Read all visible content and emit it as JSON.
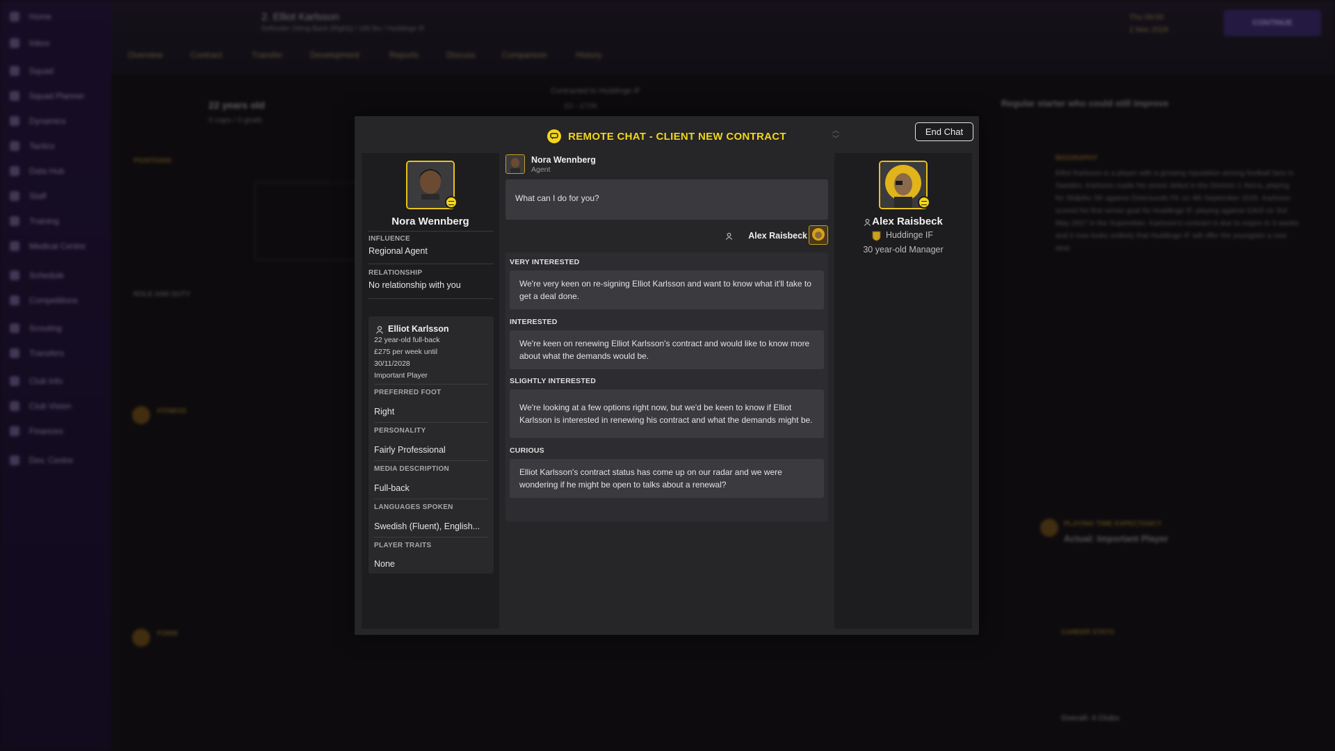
{
  "background": {
    "sidebar_items": [
      "Home",
      "Inbox",
      "Squad",
      "Squad Planner",
      "Dynamics",
      "Tactics",
      "Data Hub",
      "Staff",
      "Training",
      "Medical Centre",
      "Schedule",
      "Competitions",
      "Scouting",
      "Transfers",
      "Club Info",
      "Club Vision",
      "Finances",
      "Dev. Centre"
    ],
    "player_name": "2. Elliot Karlsson",
    "player_sub": "Defender (Wing-Back (Right)) / 180 lbs / Huddinge IF",
    "tabs": [
      "Overview",
      "Contract",
      "Transfer",
      "Development",
      "Reports",
      "Discuss",
      "Comparison",
      "History"
    ],
    "continue_label": "CONTINUE",
    "date_line1": "Thu 09:00",
    "date_line2": "2 Nov 2028",
    "age_text": "22 years old",
    "caps_text": "0 caps / 0 goals",
    "contract_text": "Contracted to Huddinge IF",
    "value_text": "£0 - £70K",
    "summary_text": "Regular starter who could still improve",
    "positions_label": "POSITIONS",
    "roles_label": "ROLE AND DUTY",
    "fitness_label": "FITNESS",
    "form_label": "FORM",
    "biography_label": "BIOGRAPHY",
    "biography_text": "Elliot Karlsson is a player with a growing reputation among football fans in Sweden. Karlsson made his senior debut in the Division 1 Norra, playing for Skiljebo SK against Östersunds FK on 4th September 2025. Karlsson scored his first senior goal for Huddinge IF, playing against GAIS on 3rd May 2027 in the Superettan. Karlsson's contract is due to expire in 3 weeks and it now looks unlikely that Huddinge IF will offer the youngster a new deal.",
    "playing_time_label": "PLAYING TIME EXPECTANCY",
    "playing_time_text": "Actual: Important Player",
    "career_label": "CAREER STATS",
    "overall_text": "Overall: 4 Clubs"
  },
  "modal": {
    "title": "REMOTE CHAT - CLIENT NEW CONTRACT",
    "end_chat_label": "End Chat",
    "agent": {
      "name": "Nora Wennberg",
      "influence_label": "INFLUENCE",
      "influence_value": "Regional Agent",
      "relationship_label": "RELATIONSHIP",
      "relationship_value": "No relationship with you"
    },
    "client": {
      "name": "Elliot Karlsson",
      "age_position": "22 year-old full-back",
      "wage_line1": "£275 per week until",
      "wage_line2": "30/11/2028",
      "status": "Important Player",
      "preferred_foot_label": "PREFERRED FOOT",
      "preferred_foot_value": "Right",
      "personality_label": "PERSONALITY",
      "personality_value": "Fairly Professional",
      "media_label": "MEDIA DESCRIPTION",
      "media_value": "Full-back",
      "languages_label": "LANGUAGES SPOKEN",
      "languages_value": "Swedish (Fluent), English...",
      "traits_label": "PLAYER TRAITS",
      "traits_value": "None"
    },
    "chat": {
      "speaker_name": "Nora Wennberg",
      "speaker_role": "Agent",
      "question": "What can I do for you?",
      "reply_name": "Alex Raisbeck",
      "options": [
        {
          "label": "VERY INTERESTED",
          "text": "We're very keen on re-signing Elliot Karlsson and want to know what it'll take to get a deal done."
        },
        {
          "label": "INTERESTED",
          "text": "We're keen on renewing Elliot Karlsson's contract and would like to know more about what the demands would be."
        },
        {
          "label": "SLIGHTLY INTERESTED",
          "text": "We're looking at a few options right now, but we'd be keen to know if Elliot Karlsson is interested in renewing his contract and what the demands might be."
        },
        {
          "label": "CURIOUS",
          "text": "Elliot Karlsson's contract status has come up on our radar and we were wondering if he might be open to talks about a renewal?"
        }
      ]
    },
    "manager": {
      "name": "Alex Raisbeck",
      "club": "Huddinge IF",
      "role": "30 year-old Manager"
    }
  },
  "colors": {
    "accent_yellow": "#f2d61a",
    "modal_bg": "#262528",
    "panel_bg": "#1d1c1f"
  }
}
